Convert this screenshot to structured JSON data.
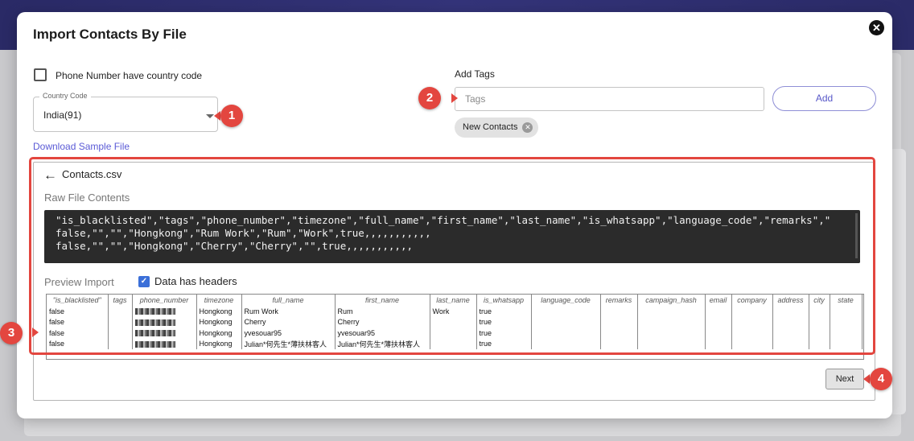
{
  "dialog": {
    "title": "Import Contacts By File",
    "close_symbol": "✕"
  },
  "phone_option": {
    "label": "Phone Number have country code",
    "checked": false
  },
  "country": {
    "legend": "Country Code",
    "value": "India(91)"
  },
  "download_link": "Download Sample File",
  "tags": {
    "label": "Add Tags",
    "placeholder": "Tags",
    "add_label": "Add",
    "chips": [
      "New Contacts"
    ]
  },
  "file": {
    "name": "Contacts.csv",
    "raw_title": "Raw File Contents",
    "raw_lines": [
      "\"is_blacklisted\",\"tags\",\"phone_number\",\"timezone\",\"full_name\",\"first_name\",\"last_name\",\"is_whatsapp\",\"language_code\",\"remarks\",\"",
      "false,\"\",\"\",\"Hongkong\",\"Rum Work\",\"Rum\",\"Work\",true,,,,,,,,,,,",
      "false,\"\",\"\",\"Hongkong\",\"Cherry\",\"Cherry\",\"\",true,,,,,,,,,,,"
    ]
  },
  "preview": {
    "title": "Preview Import",
    "headers_label": "Data has headers",
    "headers_checked": true,
    "columns": [
      "\"is_blacklisted\"",
      "tags",
      "phone_number",
      "timezone",
      "full_name",
      "first_name",
      "last_name",
      "is_whatsapp",
      "language_code",
      "remarks",
      "campaign_hash",
      "email",
      "company",
      "address",
      "city",
      "state"
    ],
    "rows": [
      [
        "false",
        "",
        "",
        "Hongkong",
        "Rum Work",
        "Rum",
        "Work",
        "true",
        "",
        "",
        "",
        "",
        "",
        "",
        "",
        ""
      ],
      [
        "false",
        "",
        "",
        "Hongkong",
        "Cherry",
        "Cherry",
        "",
        "true",
        "",
        "",
        "",
        "",
        "",
        "",
        "",
        ""
      ],
      [
        "false",
        "",
        "",
        "Hongkong",
        "yvesouar95",
        "yvesouar95",
        "",
        "true",
        "",
        "",
        "",
        "",
        "",
        "",
        "",
        ""
      ],
      [
        "false",
        "",
        "",
        "Hongkong",
        "Julian*何先生*薄扶林客人",
        "Julian*何先生*薄扶林客人",
        "",
        "true",
        "",
        "",
        "",
        "",
        "",
        "",
        "",
        ""
      ]
    ]
  },
  "next_label": "Next",
  "annotations": [
    "1",
    "2",
    "3",
    "4"
  ],
  "colors": {
    "annotation_red": "#e3463f",
    "link_purple": "#5a5ad6",
    "header_bar": "#2f2f70"
  }
}
